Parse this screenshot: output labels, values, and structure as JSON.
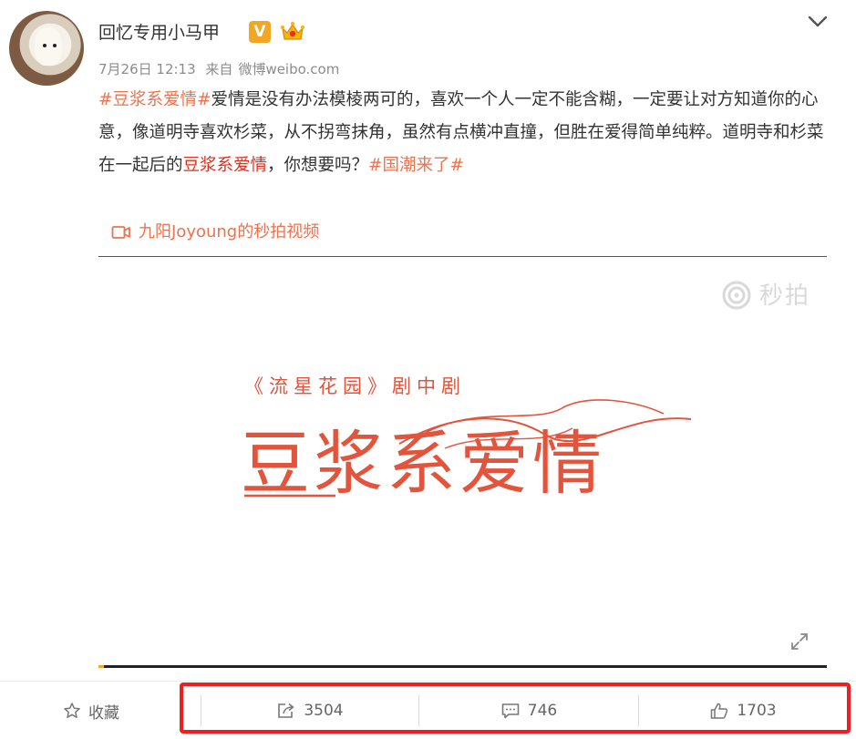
{
  "post": {
    "username": "回忆专用小马甲",
    "vip_badge": "V",
    "date": "7月26日 12:13",
    "source_prefix": "来自",
    "source": "微博weibo.com",
    "text": {
      "topic1": "#豆浆系爱情#",
      "p1": "爱情是没有办法模棱两可的，喜欢一个人一定不能含糊，一定要让对方知道你的心意，像道明寺喜欢杉菜，从不拐弯抹角，虽然有点横冲直撞，但胜在爱得简单纯粹。道明寺和杉菜在一起后的",
      "keyword": "豆浆系爱情",
      "p2": "，你想要吗？",
      "topic2": "#国潮来了#"
    },
    "video_link": "九阳Joyoung的秒拍视频"
  },
  "video": {
    "watermark": "秒拍",
    "subtitle": "《流星花园》剧中剧",
    "title": "豆浆系爱情",
    "progress": 0.008
  },
  "actions": {
    "favorite": "收藏",
    "repost_count": "3504",
    "comment_count": "746",
    "like_count": "1703"
  },
  "colors": {
    "topic": "#eb7350",
    "keyword": "#e0301e",
    "highlight": "#f01e1e",
    "video_title": "#e2543c"
  },
  "icons": [
    "chevron-down-icon",
    "crown-icon",
    "video-camera-icon",
    "miaopai-logo-icon",
    "fullscreen-icon",
    "star-icon",
    "repost-icon",
    "comment-icon",
    "like-icon"
  ]
}
